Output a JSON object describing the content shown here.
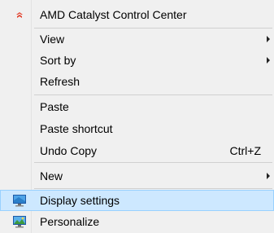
{
  "menu": {
    "items": [
      {
        "label": "AMD Catalyst Control Center",
        "icon": "amd-catalyst-icon"
      },
      {
        "label": "View",
        "submenu": true
      },
      {
        "label": "Sort by",
        "submenu": true
      },
      {
        "label": "Refresh"
      },
      {
        "label": "Paste"
      },
      {
        "label": "Paste shortcut"
      },
      {
        "label": "Undo Copy",
        "shortcut": "Ctrl+Z"
      },
      {
        "label": "New",
        "submenu": true
      },
      {
        "label": "Display settings",
        "icon": "display-settings-icon",
        "highlighted": true
      },
      {
        "label": "Personalize",
        "icon": "personalize-icon"
      }
    ]
  },
  "colors": {
    "menu_background": "#f0f0f0",
    "highlight_background": "#cde8ff",
    "highlight_border": "#99d1ff",
    "amd_icon": "#e23d28",
    "monitor_blue": "#2b7fc9"
  }
}
